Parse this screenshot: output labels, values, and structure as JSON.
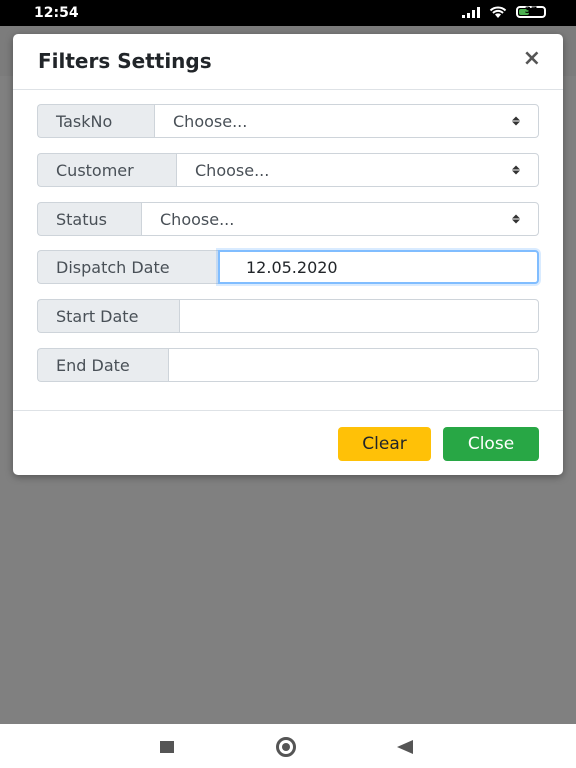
{
  "status_bar": {
    "time": "12:54",
    "battery": "37"
  },
  "modal": {
    "title": "Filters Settings",
    "close_symbol": "×",
    "fields": [
      {
        "label": "TaskNo",
        "type": "select",
        "value": "Choose..."
      },
      {
        "label": "Customer",
        "type": "select",
        "value": "Choose..."
      },
      {
        "label": "Status",
        "type": "select",
        "value": "Choose..."
      },
      {
        "label": "Dispatch Date",
        "type": "input",
        "value": "12.05.2020",
        "focused": true
      },
      {
        "label": "Start Date",
        "type": "input",
        "value": ""
      },
      {
        "label": "End Date",
        "type": "input",
        "value": ""
      }
    ],
    "footer": {
      "clear_label": "Clear",
      "close_label": "Close"
    }
  },
  "colors": {
    "clear_button": "#ffc107",
    "close_button": "#28a745",
    "focus_border": "#80bdff",
    "overlay": "#808080"
  },
  "icons": {
    "status": [
      "signal-icon",
      "wifi-icon",
      "battery-icon"
    ],
    "nav": [
      "recent-apps-icon",
      "home-icon",
      "back-icon"
    ]
  }
}
